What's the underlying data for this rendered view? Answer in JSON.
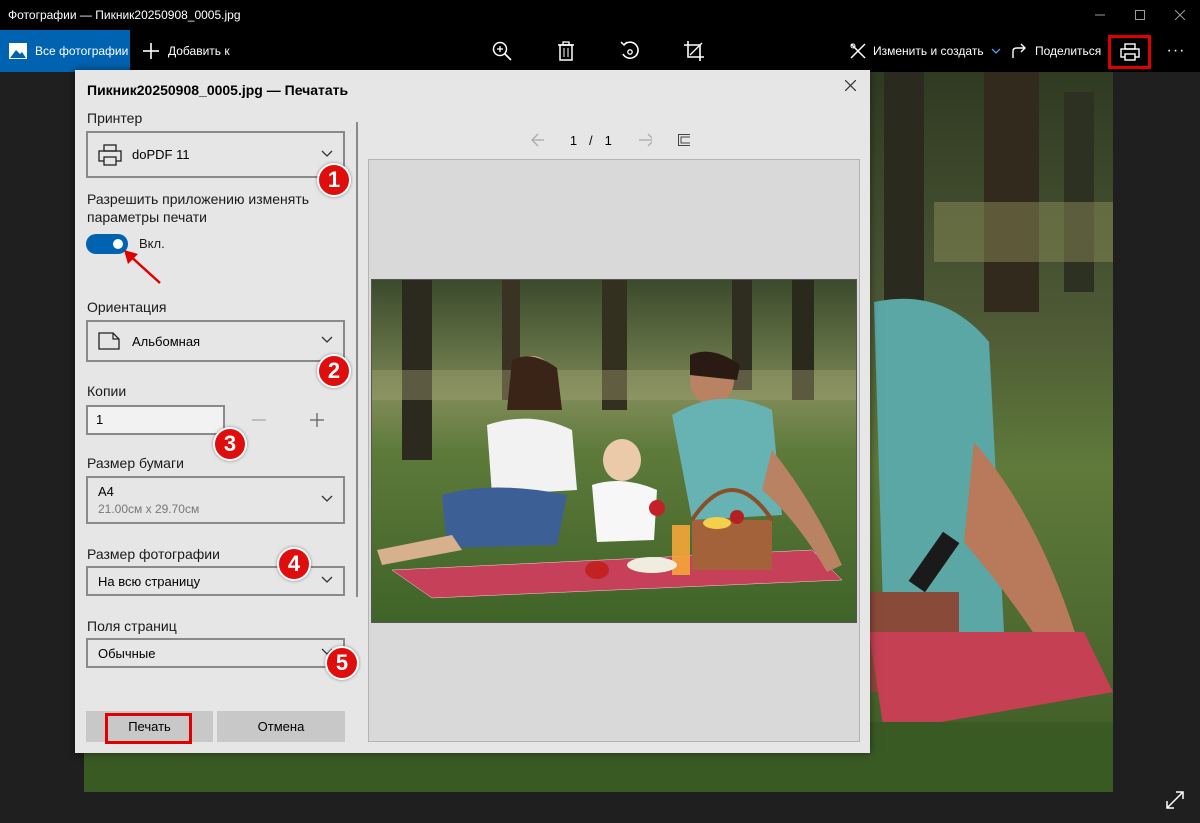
{
  "window": {
    "title": "Фотографии — Пикник20250908_0005.jpg"
  },
  "toolbar": {
    "all_photos": "Все фотографии",
    "add": "Добавить к",
    "edit_create": "Изменить и создать",
    "share": "Поделиться",
    "more": "···"
  },
  "dialog": {
    "title": "Пикник20250908_0005.jpg — Печатать",
    "printer_label": "Принтер",
    "printer_value": "doPDF 11",
    "allow_label": "Разрешить приложению изменять параметры печати",
    "toggle_state": "Вкл.",
    "orientation_label": "Ориентация",
    "orientation_value": "Альбомная",
    "copies_label": "Копии",
    "copies_value": "1",
    "paper_label": "Размер бумаги",
    "paper_value": "A4",
    "paper_dims": "21.00см x 29.70см",
    "photo_size_label": "Размер фотографии",
    "photo_size_value": "На всю страницу",
    "margins_label": "Поля страниц",
    "margins_value": "Обычные",
    "print_button": "Печать",
    "cancel_button": "Отмена",
    "page_current": "1",
    "page_sep": "/",
    "page_total": "1"
  },
  "markers": [
    "1",
    "2",
    "3",
    "4",
    "5"
  ],
  "colors": {
    "accent": "#0063b1",
    "highlight": "#e00000",
    "dialog_bg": "#e6e6e6"
  }
}
